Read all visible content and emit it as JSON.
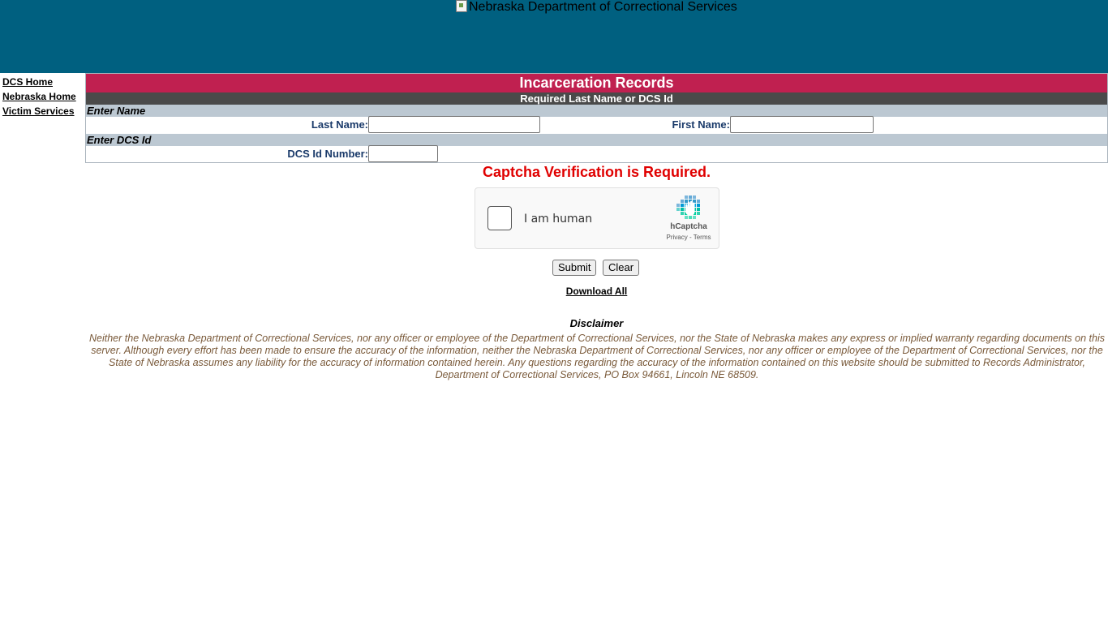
{
  "header": {
    "logo_alt": "Nebraska Department of Correctional Services",
    "background": "#006080"
  },
  "sidenav": {
    "items": [
      {
        "label": "DCS Home"
      },
      {
        "label": "Nebraska Home"
      },
      {
        "label": "Victim Services"
      }
    ]
  },
  "form": {
    "title": "Incarceration Records",
    "subtitle": "Required Last Name or DCS Id",
    "name_section": "Enter Name",
    "last_name_label": "Last Name:",
    "last_name_value": "",
    "first_name_label": "First Name:",
    "first_name_value": "",
    "dcs_section": "Enter DCS Id",
    "dcs_id_label": "DCS Id Number:",
    "dcs_id_value": "",
    "title_color": "#c02050",
    "subtitle_color": "#4a4a4a",
    "section_color": "#bcc8d2"
  },
  "captcha": {
    "warning": "Captcha Verification is Required.",
    "checkbox_label": "I am human",
    "brand": "hCaptcha",
    "links": "Privacy - Terms",
    "warning_color": "#e00000"
  },
  "buttons": {
    "submit": "Submit",
    "clear": "Clear"
  },
  "download": {
    "label": "Download All"
  },
  "disclaimer": {
    "title": "Disclaimer",
    "text": "Neither the Nebraska Department of Correctional Services, nor any officer or employee of the Department of Correctional Services, nor the State of Nebraska makes any express or implied warranty regarding documents on this server. Although every effort has been made to ensure the accuracy of the information, neither the Nebraska Department of Correctional Services, nor any officer or employee of the Department of Correctional Services, nor the State of Nebraska assumes any liability for the accuracy of information contained herein. Any questions regarding the accuracy of the information contained on this website should be submitted to Records Administrator, Department of Correctional Services, PO Box 94661, Lincoln NE 68509."
  }
}
